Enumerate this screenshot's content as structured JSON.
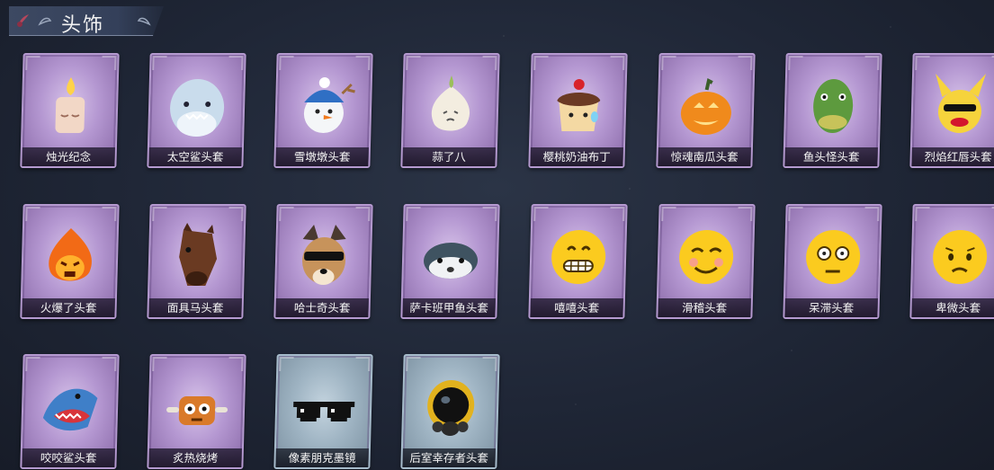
{
  "header": {
    "title": "头饰"
  },
  "items": [
    {
      "label": "烛光纪念",
      "icon": "candle-icon",
      "rarity": "purple"
    },
    {
      "label": "太空鲨头套",
      "icon": "space-shark-icon",
      "rarity": "purple"
    },
    {
      "label": "雪墩墩头套",
      "icon": "snowman-icon",
      "rarity": "purple"
    },
    {
      "label": "蒜了八",
      "icon": "garlic-icon",
      "rarity": "purple"
    },
    {
      "label": "樱桃奶油布丁",
      "icon": "pudding-icon",
      "rarity": "purple"
    },
    {
      "label": "惊魂南瓜头套",
      "icon": "pumpkin-icon",
      "rarity": "purple"
    },
    {
      "label": "鱼头怪头套",
      "icon": "fish-head-icon",
      "rarity": "purple"
    },
    {
      "label": "烈焰红唇头套",
      "icon": "pikachu-lips-icon",
      "rarity": "purple"
    },
    {
      "label": "火爆了头套",
      "icon": "fireball-icon",
      "rarity": "purple"
    },
    {
      "label": "面具马头套",
      "icon": "horse-mask-icon",
      "rarity": "purple"
    },
    {
      "label": "哈士奇头套",
      "icon": "husky-icon",
      "rarity": "purple"
    },
    {
      "label": "萨卡班甲鱼头套",
      "icon": "sacabambaspis-icon",
      "rarity": "purple"
    },
    {
      "label": "嘻嘻头套",
      "icon": "grin-emoji-icon",
      "rarity": "purple"
    },
    {
      "label": "滑稽头套",
      "icon": "funny-emoji-icon",
      "rarity": "purple"
    },
    {
      "label": "呆滞头套",
      "icon": "dazed-emoji-icon",
      "rarity": "purple"
    },
    {
      "label": "卑微头套",
      "icon": "humble-emoji-icon",
      "rarity": "purple"
    },
    {
      "label": "咬咬鲨头套",
      "icon": "biting-shark-icon",
      "rarity": "purple"
    },
    {
      "label": "炙热烧烤",
      "icon": "bbq-icon",
      "rarity": "purple"
    },
    {
      "label": "像素朋克墨镜",
      "icon": "pixel-sunglasses-icon",
      "rarity": "blue"
    },
    {
      "label": "后室幸存者头套",
      "icon": "gas-mask-helmet-icon",
      "rarity": "blue"
    }
  ]
}
